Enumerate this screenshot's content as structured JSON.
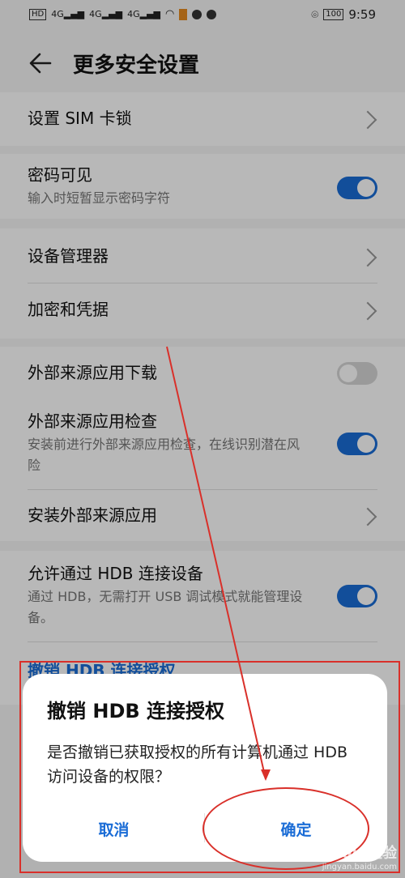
{
  "status_bar": {
    "network_label": "HD",
    "signal_labels": [
      "4G",
      "4G",
      "4G"
    ],
    "battery": "100",
    "time": "9:59"
  },
  "header": {
    "title": "更多安全设置"
  },
  "settings": {
    "sim_lock": {
      "label": "设置 SIM 卡锁"
    },
    "password_visible": {
      "label": "密码可见",
      "subtitle": "输入时短暂显示密码字符",
      "enabled": true
    },
    "device_admin": {
      "label": "设备管理器"
    },
    "encryption": {
      "label": "加密和凭据"
    },
    "external_download": {
      "label": "外部来源应用下载",
      "enabled": false
    },
    "external_check": {
      "label": "外部来源应用检查",
      "subtitle": "安装前进行外部来源应用检查，在线识别潜在风险",
      "enabled": true
    },
    "install_external": {
      "label": "安装外部来源应用"
    },
    "hdb": {
      "label": "允许通过 HDB 连接设备",
      "subtitle": "通过 HDB，无需打开 USB 调试模式就能管理设备。",
      "enabled": true
    },
    "revoke_link": "撤销 HDB 连接授权"
  },
  "dialog": {
    "title": "撤销 HDB 连接授权",
    "message": "是否撤销已获取授权的所有计算机通过 HDB 访问设备的权限？",
    "cancel_label": "取消",
    "confirm_label": "确定"
  },
  "watermark": {
    "brand": "Baidu 经验",
    "site": "jingyan.baidu.com"
  },
  "colors": {
    "accent": "#1a6cd6",
    "annotation": "#d9302a"
  }
}
